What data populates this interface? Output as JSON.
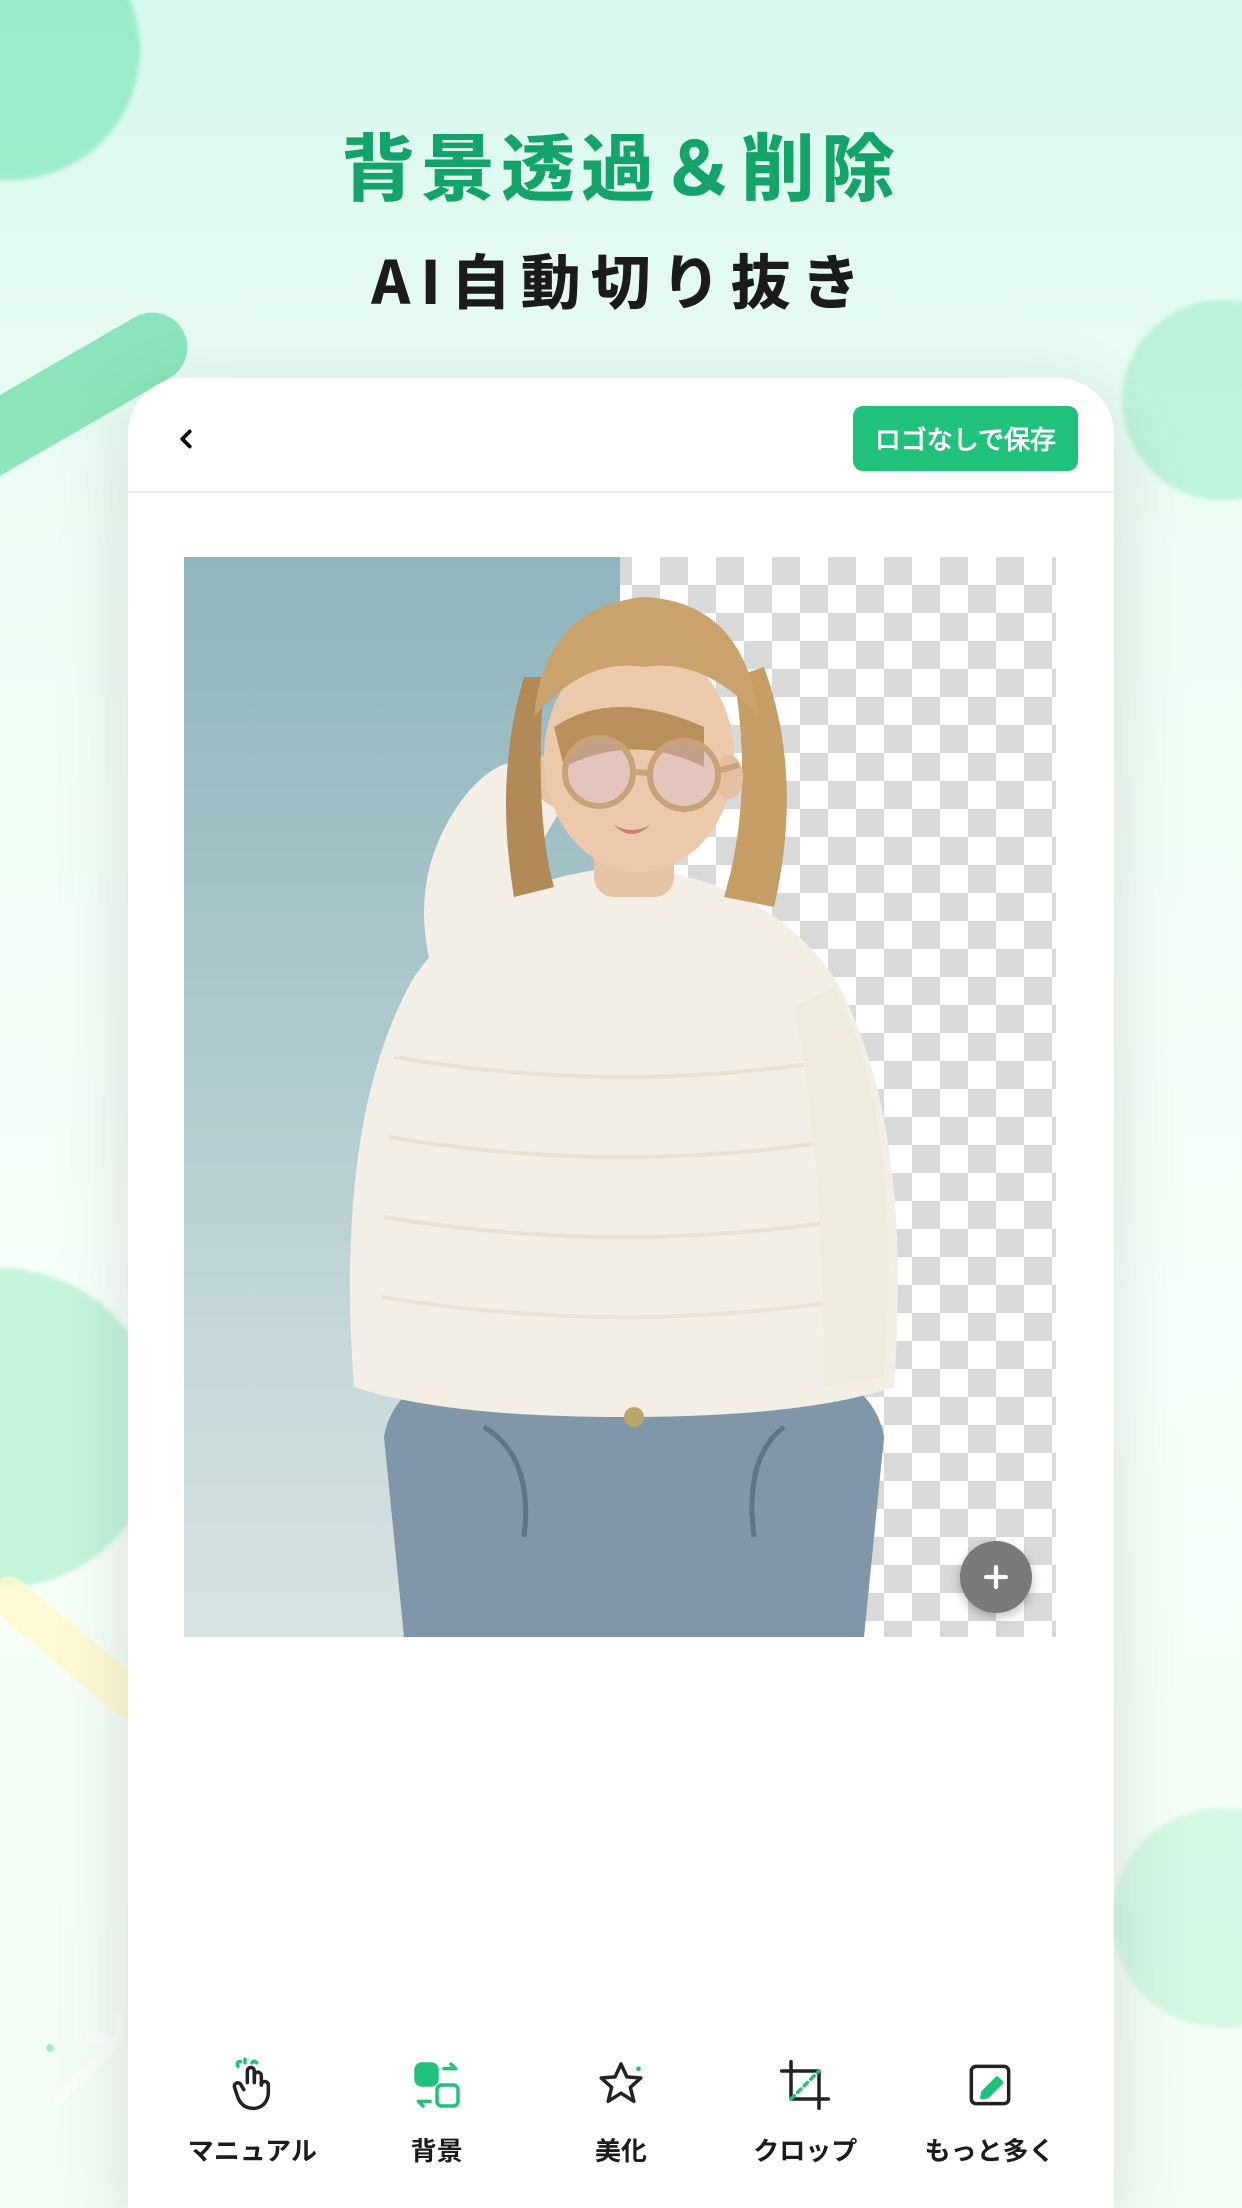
{
  "headline": {
    "title": "背景透過＆削除",
    "subtitle": "AI自動切り抜き"
  },
  "topbar": {
    "save_label": "ロゴなしで保存"
  },
  "toolbar": {
    "manual": {
      "label": "マニュアル"
    },
    "background": {
      "label": "背景"
    },
    "beautify": {
      "label": "美化"
    },
    "crop": {
      "label": "クロップ"
    },
    "more": {
      "label": "もっと多く"
    }
  },
  "colors": {
    "accent": "#1fc17b",
    "headline": "#14a469"
  }
}
